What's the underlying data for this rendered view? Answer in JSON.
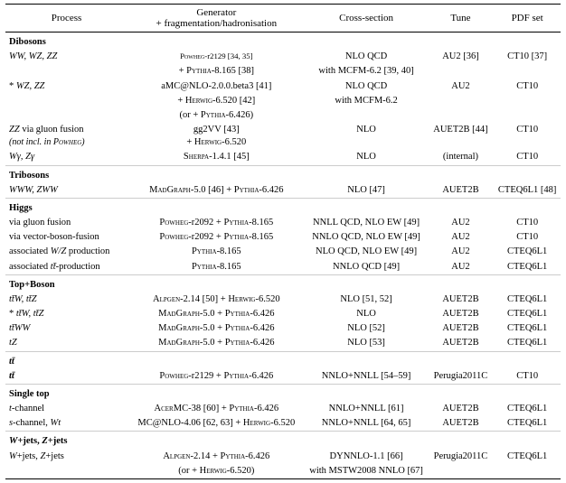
{
  "table": {
    "headers": {
      "process": "Process",
      "generator": "Generator\n+ fragmentation/hadronisation",
      "xsec": "Cross-section",
      "tune": "Tune",
      "pdf": "PDF set"
    },
    "sections": [
      {
        "id": "dibosons",
        "header": "Dibosons",
        "rows": [
          {
            "process": "WW, WZ, ZZ",
            "generator": "Powheg-r2129 [34, 35]",
            "xsec": "NLO QCD",
            "tune": "AU2 [36]",
            "pdf": "CT10 [37]"
          },
          {
            "process": "",
            "generator": "+ Pythia-8.165 [38]",
            "xsec": "with MCFM-6.2 [39, 40]",
            "tune": "",
            "pdf": ""
          },
          {
            "process": "* WZ, ZZ",
            "generator": "aMC@NLO-2.0.0.beta3 [41]",
            "xsec": "NLO QCD",
            "tune": "AU2",
            "pdf": "CT10"
          },
          {
            "process": "",
            "generator": "+ Herwig-6.520 [42]",
            "xsec": "with MCFM-6.2",
            "tune": "",
            "pdf": ""
          },
          {
            "process": "",
            "generator": "(or + Pythia-6.426)",
            "xsec": "",
            "tune": "",
            "pdf": ""
          },
          {
            "process": "ZZ via gluon fusion",
            "generator": "gg2VV [43]",
            "xsec": "NLO",
            "tune": "AUET2B [44]",
            "pdf": "CT10"
          },
          {
            "process": "(not incl. in Powheg)",
            "generator": "+ Herwig-6.520",
            "xsec": "",
            "tune": "",
            "pdf": ""
          },
          {
            "process": "Wγ, Zγ",
            "generator": "Sherpa-1.4.1 [45]",
            "xsec": "NLO",
            "tune": "(internal)",
            "pdf": "CT10"
          }
        ]
      },
      {
        "id": "tribosons",
        "header": "Tribosons",
        "rows": [
          {
            "process": "WWW, ZWW",
            "generator": "MadGraph-5.0 [46] + Pythia-6.426",
            "xsec": "NLO [47]",
            "tune": "AUET2B",
            "pdf": "CTEQ6L1 [48]"
          }
        ]
      },
      {
        "id": "higgs",
        "header": "Higgs",
        "rows": [
          {
            "process": "via gluon fusion",
            "generator": "Powheg-r2092 + Pythia-8.165",
            "xsec": "NNLL QCD, NLO EW [49]",
            "tune": "AU2",
            "pdf": "CT10"
          },
          {
            "process": "via vector-boson-fusion",
            "generator": "Powheg-r2092 + Pythia-8.165",
            "xsec": "NNLO QCD, NLO EW [49]",
            "tune": "AU2",
            "pdf": "CT10"
          },
          {
            "process": "associated W/Z production",
            "generator": "Pythia-8.165",
            "xsec": "NLO QCD, NLO EW [49]",
            "tune": "AU2",
            "pdf": "CTEQ6L1"
          },
          {
            "process": "associated tt̄-production",
            "generator": "Pythia-8.165",
            "xsec": "NNLO QCD [49]",
            "tune": "AU2",
            "pdf": "CTEQ6L1"
          }
        ]
      },
      {
        "id": "top-boson",
        "header": "Top+Boson",
        "rows": [
          {
            "process": "ttW, ttZ",
            "generator": "Alpgen-2.14 [50] + Herwig-6.520",
            "xsec": "NLO [51, 52]",
            "tune": "AUET2B",
            "pdf": "CTEQ6L1"
          },
          {
            "process": "* ttW, ttZ",
            "generator": "MadGraph-5.0 + Pythia-6.426",
            "xsec": "NLO",
            "tune": "AUET2B",
            "pdf": "CTEQ6L1"
          },
          {
            "process": "ttWW",
            "generator": "MadGraph-5.0 + Pythia-6.426",
            "xsec": "NLO [52]",
            "tune": "AUET2B",
            "pdf": "CTEQ6L1"
          },
          {
            "process": "tZ",
            "generator": "MadGraph-5.0 + Pythia-6.426",
            "xsec": "NLO [53]",
            "tune": "AUET2B",
            "pdf": "CTEQ6L1"
          }
        ]
      },
      {
        "id": "ttbar",
        "header": "tt̄",
        "rows": [
          {
            "process": "tt̄",
            "generator": "Powheg-r2129 + Pythia-6.426",
            "xsec": "NNLO+NNLL [54–59]",
            "tune": "Perugia2011C",
            "pdf": "CT10"
          }
        ]
      },
      {
        "id": "single-top",
        "header": "Single top",
        "rows": [
          {
            "process": "t-channel",
            "generator": "AcerMC-38 [60] + Pythia-6.426",
            "xsec": "NNLO+NNLL [61]",
            "tune": "AUET2B",
            "pdf": "CTEQ6L1"
          },
          {
            "process": "s-channel, Wt",
            "generator": "MC@NLO-4.06 [62, 63] + Herwig-6.520",
            "xsec": "NNLO+NNLL [64, 65]",
            "tune": "AUET2B",
            "pdf": "CTEQ6L1"
          }
        ]
      },
      {
        "id": "w-z-jets",
        "header": "W+jets, Z+jets",
        "rows": [
          {
            "process": "W+jets, Z+jets",
            "generator": "Alpgen-2.14 + Pythia-6.426",
            "xsec": "DYNNLO-1.1 [66]",
            "tune": "Perugia2011C",
            "pdf": "CTEQ6L1"
          },
          {
            "process": "",
            "generator": "(or + Herwig-6.520)",
            "xsec": "with MSTW2008 NNLO [67]",
            "tune": "",
            "pdf": ""
          }
        ]
      }
    ]
  }
}
